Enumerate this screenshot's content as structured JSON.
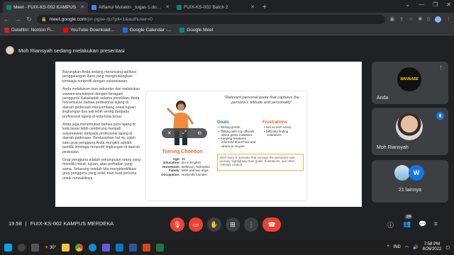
{
  "browser": {
    "tabs": [
      {
        "label": "Meet - FUIX-KS-002 KAMPUS",
        "fav_color": "#00897b",
        "active": true
      },
      {
        "label": "Alfianul Mutakin _tugas 1.docx -",
        "fav_color": "#4285f4",
        "active": false
      },
      {
        "label": "FUIX-KS-002 Batch 2",
        "fav_color": "#00897b",
        "active": false
      }
    ],
    "new_tab": "+",
    "url_host": "meet.google.com",
    "url_path": "/jsr-pgoe-rju?pli=1&authuser=0",
    "bookmarks": [
      {
        "label": "Dutafilm: Nonton Fi...",
        "color": "#c62828"
      },
      {
        "label": "YouTube Download...",
        "color": "#ff0000"
      },
      {
        "label": "Google Calendar -...",
        "color": "#1a73e8"
      },
      {
        "label": "Google Meet",
        "color": "#00897b"
      }
    ]
  },
  "meet": {
    "presenter_banner": "Moh Riansyah sedang melakukan presentasi",
    "time": "19.58",
    "separator": "|",
    "meeting_name": "FUIX-KS-002 KAMPUS MERDEKA",
    "participant_badge": "24",
    "tiles": [
      {
        "name": "Anda",
        "avatar_text": "WANNABE"
      },
      {
        "name": "Moh Riansyah"
      },
      {
        "name": "21 lainnya",
        "avatar_letter": "W"
      }
    ]
  },
  "slide": {
    "paragraphs": [
      "Bayangkan Anda sedang merancang aplikasi penggalangan dana yang menghubungkan lembaga nonprofit dengan sukarelawan.",
      "Anda melakukan riset sekunder dan melakukan wawancara telepon dengan beragam pengguna. Katakanlah selama penelitian, Anda menemukan bahwa profesional lajang di daerah pedesaan menyumbang untuk tujuan lingkungan dua kali lebih sering daripada profesional lajang di kota-kota besar.",
      "Anda juga menemukan bahwa para lajang di kota besar lebih cenderung menjadi sukarelawan daripada profesional lajang di daerah pedesaan. Berdasarkan hal ini, salah satu grup pengguna Anda mungkin adalah pemilik lembaga nonprofit lingkungan di daerah pedesaan.",
      "Grup pengguna adalah sekumpulan orang yang memiliki minat, tujuan, atau perhatian yang sama. Sekarang setelah kita mengidentifikasi grup pengguna yang solid, mari buat persona untuk mewakilinya."
    ],
    "persona": {
      "name": "Tsering Choedon",
      "facts": [
        {
          "key": "Age:",
          "value": "35"
        },
        {
          "key": "Education:",
          "value": "BA in English"
        },
        {
          "key": "Hometown:",
          "value": "Bellevue, Nebraska"
        },
        {
          "key": "Family:",
          "value": "Wife and two dogs"
        },
        {
          "key": "Occupation:",
          "value": "Nonprofit founder"
        }
      ],
      "quote": "\"Relevant personal quote that captures the persona's attitude and personality\"",
      "goals_title": "Goals",
      "goals": [
        "Writing grants",
        "Talking with city officials about green initiatives",
        "Keeping residents informed about how and where to recycle"
      ],
      "frustrations_title": "Frustrations",
      "frustrations": [
        "Not so tech savvy",
        "Difficulty finding volunteers"
      ],
      "brief": "Brief story or scenario that conveys the persona's user journey, highlighting their goals, frustrations, and other relevant context."
    }
  },
  "taskbar": {
    "temperature": "30°",
    "language": "IND",
    "time": "7:58 PM",
    "date": "8/26/2022"
  }
}
